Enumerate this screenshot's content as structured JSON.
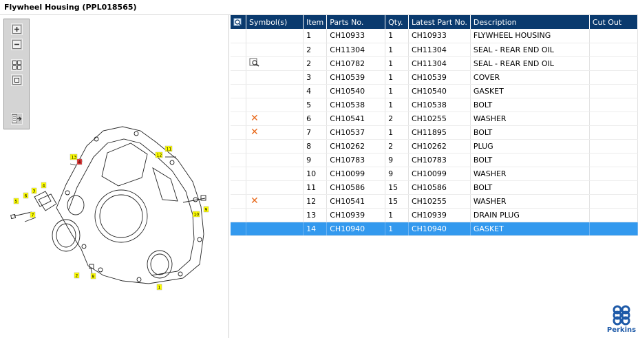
{
  "window": {
    "title": "Flywheel Housing (PPL018565)"
  },
  "toolbar": {
    "buttons": [
      {
        "name": "zoom-in",
        "icon": "zoom-in-icon"
      },
      {
        "name": "zoom-out",
        "icon": "zoom-out-icon"
      },
      {
        "name": "fit-all",
        "icon": "fit-all-icon"
      },
      {
        "name": "actual-size",
        "icon": "actual-size-icon"
      },
      {
        "name": "sync-list",
        "icon": "sync-list-icon"
      }
    ]
  },
  "diagram": {
    "callouts": [
      "1",
      "2",
      "3",
      "4",
      "5",
      "6",
      "7",
      "8",
      "9",
      "10",
      "11",
      "12",
      "13",
      "4"
    ],
    "callout_color": "#ffff00",
    "highlight_color": "#e03030"
  },
  "table": {
    "columns": [
      "",
      "Symbol(s)",
      "Item",
      "Parts No.",
      "Qty.",
      "Latest Part No.",
      "Description",
      "Cut Out"
    ],
    "rows": [
      {
        "symbol": "",
        "item": "1",
        "part": "CH10933",
        "qty": "1",
        "latest": "CH10933",
        "desc": "FLYWHEEL HOUSING",
        "cut": ""
      },
      {
        "symbol": "",
        "item": "2",
        "part": "CH11304",
        "qty": "1",
        "latest": "CH11304",
        "desc": "SEAL - REAR END OIL",
        "cut": ""
      },
      {
        "symbol": "view",
        "item": "2",
        "part": "CH10782",
        "qty": "1",
        "latest": "CH11304",
        "desc": "SEAL - REAR END OIL",
        "cut": ""
      },
      {
        "symbol": "",
        "item": "3",
        "part": "CH10539",
        "qty": "1",
        "latest": "CH10539",
        "desc": "COVER",
        "cut": ""
      },
      {
        "symbol": "",
        "item": "4",
        "part": "CH10540",
        "qty": "1",
        "latest": "CH10540",
        "desc": "GASKET",
        "cut": ""
      },
      {
        "symbol": "",
        "item": "5",
        "part": "CH10538",
        "qty": "1",
        "latest": "CH10538",
        "desc": "BOLT",
        "cut": ""
      },
      {
        "symbol": "cross",
        "item": "6",
        "part": "CH10541",
        "qty": "2",
        "latest": "CH10255",
        "desc": "WASHER",
        "cut": ""
      },
      {
        "symbol": "cross",
        "item": "7",
        "part": "CH10537",
        "qty": "1",
        "latest": "CH11895",
        "desc": "BOLT",
        "cut": ""
      },
      {
        "symbol": "",
        "item": "8",
        "part": "CH10262",
        "qty": "2",
        "latest": "CH10262",
        "desc": "PLUG",
        "cut": ""
      },
      {
        "symbol": "",
        "item": "9",
        "part": "CH10783",
        "qty": "9",
        "latest": "CH10783",
        "desc": "BOLT",
        "cut": ""
      },
      {
        "symbol": "",
        "item": "10",
        "part": "CH10099",
        "qty": "9",
        "latest": "CH10099",
        "desc": "WASHER",
        "cut": ""
      },
      {
        "symbol": "",
        "item": "11",
        "part": "CH10586",
        "qty": "15",
        "latest": "CH10586",
        "desc": "BOLT",
        "cut": ""
      },
      {
        "symbol": "cross",
        "item": "12",
        "part": "CH10541",
        "qty": "15",
        "latest": "CH10255",
        "desc": "WASHER",
        "cut": ""
      },
      {
        "symbol": "",
        "item": "13",
        "part": "CH10939",
        "qty": "1",
        "latest": "CH10939",
        "desc": "DRAIN PLUG",
        "cut": ""
      },
      {
        "symbol": "",
        "item": "14",
        "part": "CH10940",
        "qty": "1",
        "latest": "CH10940",
        "desc": "GASKET",
        "cut": "",
        "selected": true
      }
    ]
  },
  "colors": {
    "header_bg": "#0a3a6e",
    "selected_bg": "#3399ee",
    "symbol_cross": "#e86a1c"
  },
  "logo": {
    "text": "Perkins"
  }
}
